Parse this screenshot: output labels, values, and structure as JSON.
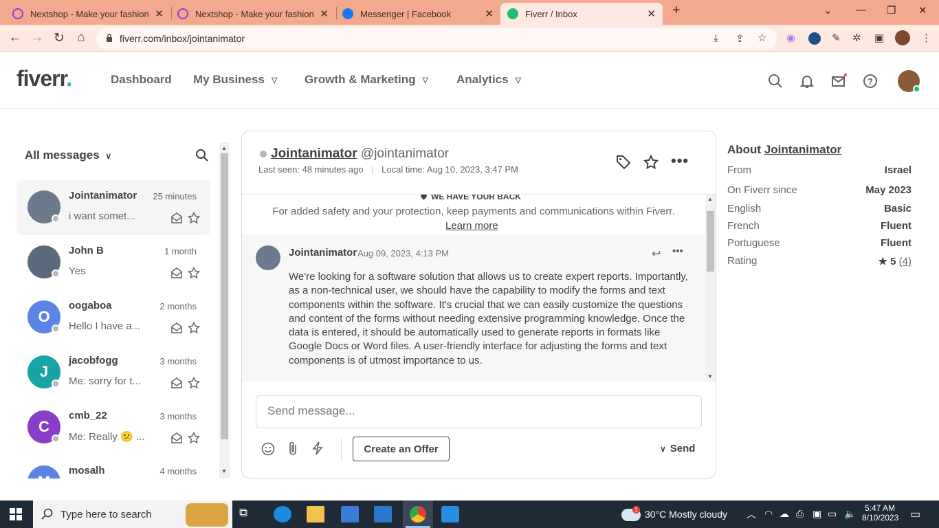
{
  "browser": {
    "tabs": [
      {
        "title": "Nextshop - Make your fashion m",
        "icon": "nextshop-icon",
        "color": "#8b3fd9"
      },
      {
        "title": "Nextshop - Make your fashion m",
        "icon": "nextshop-icon",
        "color": "#8b3fd9"
      },
      {
        "title": "Messenger | Facebook",
        "icon": "facebook-icon",
        "color": "#1877f2"
      },
      {
        "title": "Fiverr / Inbox",
        "icon": "fiverr-icon",
        "color": "#1dbf73"
      }
    ],
    "url": "fiverr.com/inbox/jointanimator"
  },
  "header": {
    "logo": "fiverr",
    "nav": [
      "Dashboard",
      "My Business",
      "Growth & Marketing",
      "Analytics"
    ]
  },
  "inbox": {
    "filter_label": "All messages",
    "conversations": [
      {
        "name": "Jointanimator",
        "time": "25 minutes",
        "preview": "i want somet...",
        "avatar_letter": "",
        "avatar_color": "#6b7a8c"
      },
      {
        "name": "John B",
        "time": "1 month",
        "preview": "Yes",
        "avatar_letter": "",
        "avatar_color": "#5a6b7d"
      },
      {
        "name": "oogaboa",
        "time": "2 months",
        "preview": "Hello I have a...",
        "avatar_letter": "O",
        "avatar_color": "#5b84e6"
      },
      {
        "name": "jacobfogg",
        "time": "3 months",
        "preview": "Me: sorry for t...",
        "avatar_letter": "J",
        "avatar_color": "#1aa3a3"
      },
      {
        "name": "cmb_22",
        "time": "3 months",
        "preview": "Me: Really 😕 ...",
        "avatar_letter": "C",
        "avatar_color": "#8a3dc8"
      },
      {
        "name": "mosalh",
        "time": "4 months",
        "preview": "",
        "avatar_letter": "M",
        "avatar_color": "#5b84e6"
      }
    ]
  },
  "chat": {
    "contact_name": "Jointanimator",
    "contact_handle": "@jointanimator",
    "last_seen": "Last seen: 48 minutes ago",
    "local_time": "Local time: Aug 10, 2023, 3:47 PM",
    "safety_title": "WE HAVE YOUR BACK",
    "safety_text": "For added safety and your protection, keep payments and communications within Fiverr.",
    "learn_more": "Learn more",
    "message": {
      "sender": "Jointanimator",
      "timestamp": "Aug 09, 2023, 4:13 PM",
      "text": "We're looking for a software solution that allows us to create expert reports. Importantly, as a non-technical user, we should have the capability to modify the forms and text components within the software. It's crucial that we can easily customize the questions and content of the forms without needing extensive programming knowledge. Once the data is entered, it should be automatically used to generate reports in formats like Google Docs or Word files. A user-friendly interface for adjusting the forms and text components is of utmost importance to us."
    },
    "input_placeholder": "Send message...",
    "create_offer": "Create an Offer",
    "send": "Send"
  },
  "about": {
    "title": "About",
    "name": "Jointanimator",
    "rows": [
      {
        "label": "From",
        "value": "Israel"
      },
      {
        "label": "On Fiverr since",
        "value": "May 2023"
      },
      {
        "label": "English",
        "value": "Basic"
      },
      {
        "label": "French",
        "value": "Fluent"
      },
      {
        "label": "Portuguese",
        "value": "Fluent"
      }
    ],
    "rating_label": "Rating",
    "rating_value": "5",
    "rating_count": "(4)"
  },
  "taskbar": {
    "search_placeholder": "Type here to search",
    "weather_badge": "1",
    "weather": "30°C  Mostly cloudy",
    "time": "5:47 AM",
    "date": "8/10/2023"
  }
}
